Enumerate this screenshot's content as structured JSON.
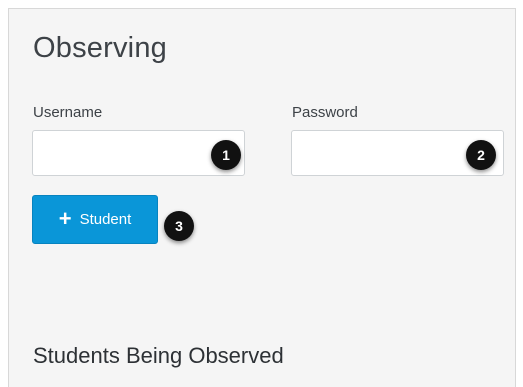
{
  "section": {
    "title": "Observing",
    "username_label": "Username",
    "password_label": "Password",
    "username_value": "",
    "password_value": "",
    "add_button_label": "Student",
    "add_icon": "plus-icon",
    "observed_title": "Students Being Observed"
  },
  "callouts": {
    "one": "1",
    "two": "2",
    "three": "3"
  },
  "colors": {
    "button_blue": "#0a96d8",
    "badge_black": "#111111",
    "panel_bg": "#f5f5f5"
  }
}
